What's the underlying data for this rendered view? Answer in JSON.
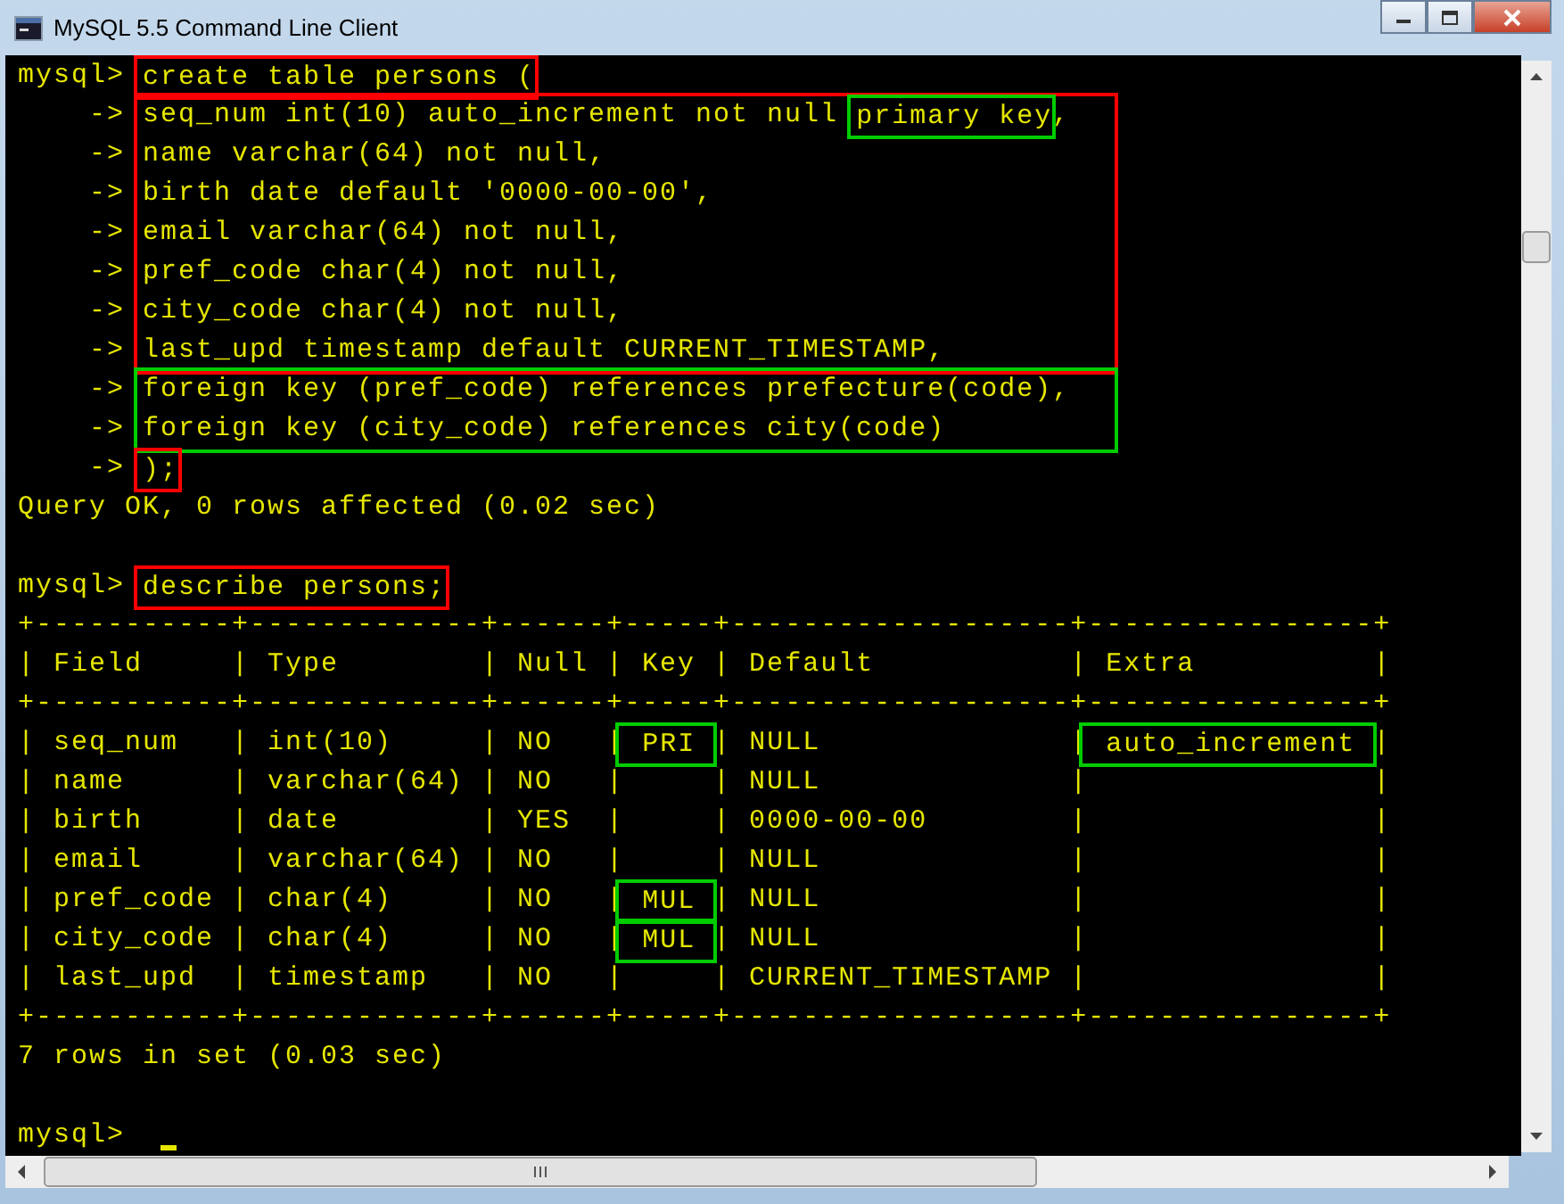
{
  "window": {
    "title": "MySQL 5.5 Command Line Client"
  },
  "lines": [
    {
      "kind": "line",
      "prompt": "mysql>",
      "segments": [
        {
          "text": "create table persons (",
          "color": "#ff0000"
        }
      ]
    },
    {
      "kind": "group",
      "color": "#ff0000",
      "lines": [
        {
          "prompt": "->",
          "segments": [
            {
              "text": "seq_num int(10) auto_increment not null "
            },
            {
              "text": "primary key",
              "color": "#00cc00"
            },
            {
              "text": ","
            }
          ]
        },
        {
          "prompt": "->",
          "segments": [
            {
              "text": "name varchar(64) not null,"
            }
          ]
        },
        {
          "prompt": "->",
          "segments": [
            {
              "text": "birth date default '0000-00-00',"
            }
          ]
        },
        {
          "prompt": "->",
          "segments": [
            {
              "text": "email varchar(64) not null,"
            }
          ]
        },
        {
          "prompt": "->",
          "segments": [
            {
              "text": "pref_code char(4) not null,"
            }
          ]
        },
        {
          "prompt": "->",
          "segments": [
            {
              "text": "city_code char(4) not null,"
            }
          ]
        },
        {
          "prompt": "->",
          "segments": [
            {
              "text": "last_upd timestamp default CURRENT_TIMESTAMP,"
            }
          ]
        }
      ]
    },
    {
      "kind": "group",
      "color": "#00cc00",
      "lines": [
        {
          "prompt": "->",
          "segments": [
            {
              "text": "foreign key (pref_code) references prefecture(code),"
            }
          ]
        },
        {
          "prompt": "->",
          "segments": [
            {
              "text": "foreign key (city_code) references city(code)"
            }
          ]
        }
      ]
    },
    {
      "kind": "line",
      "prompt": "->",
      "segments": [
        {
          "text": ");",
          "color": "#ff0000"
        }
      ]
    },
    {
      "kind": "line",
      "segments": [
        {
          "text": "Query OK, 0 rows affected (0.02 sec)"
        }
      ]
    },
    {
      "kind": "blank"
    },
    {
      "kind": "line",
      "prompt": "mysql>",
      "segments": [
        {
          "text": "describe persons;",
          "color": "#ff0000"
        }
      ]
    },
    {
      "kind": "line",
      "segments": [
        {
          "text": "+-----------+-------------+------+-----+-------------------+----------------+"
        }
      ]
    },
    {
      "kind": "line",
      "segments": [
        {
          "text": "| Field     | Type        | Null | Key | Default           | Extra          |"
        }
      ]
    },
    {
      "kind": "line",
      "segments": [
        {
          "text": "+-----------+-------------+------+-----+-------------------+----------------+"
        }
      ]
    },
    {
      "kind": "line",
      "segments": [
        {
          "text": "| seq_num   | int(10)     | NO   |"
        },
        {
          "text": " PRI ",
          "color": "#00cc00"
        },
        {
          "text": "| NULL              |"
        },
        {
          "text": " auto_increment ",
          "color": "#00cc00"
        },
        {
          "text": "|"
        }
      ]
    },
    {
      "kind": "line",
      "segments": [
        {
          "text": "| name      | varchar(64) | NO   |     | NULL              |                |"
        }
      ]
    },
    {
      "kind": "line",
      "segments": [
        {
          "text": "| birth     | date        | YES  |     | 0000-00-00        |                |"
        }
      ]
    },
    {
      "kind": "line",
      "segments": [
        {
          "text": "| email     | varchar(64) | NO   |     | NULL              |                |"
        }
      ]
    },
    {
      "kind": "line",
      "segments": [
        {
          "text": "| pref_code | char(4)     | NO   |"
        },
        {
          "text": " MUL ",
          "color": "#00cc00"
        },
        {
          "text": "| NULL              |                |"
        }
      ]
    },
    {
      "kind": "line",
      "segments": [
        {
          "text": "| city_code | char(4)     | NO   |"
        },
        {
          "text": " MUL ",
          "color": "#00cc00"
        },
        {
          "text": "| NULL              |                |"
        }
      ]
    },
    {
      "kind": "line",
      "segments": [
        {
          "text": "| last_upd  | timestamp   | NO   |     | CURRENT_TIMESTAMP |                |"
        }
      ]
    },
    {
      "kind": "line",
      "segments": [
        {
          "text": "+-----------+-------------+------+-----+-------------------+----------------+"
        }
      ]
    },
    {
      "kind": "line",
      "segments": [
        {
          "text": "7 rows in set (0.03 sec)"
        }
      ]
    },
    {
      "kind": "blank"
    },
    {
      "kind": "line",
      "prompt": "mysql>",
      "cursor": true
    }
  ]
}
